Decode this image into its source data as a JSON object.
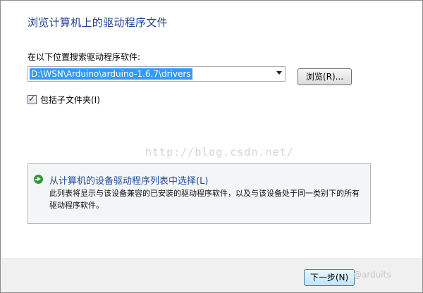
{
  "dialog": {
    "title": "浏览计算机上的驱动程序文件",
    "search_label": "在以下位置搜索驱动程序软件:",
    "path_value": "D:\\WSN\\Arduino\\arduino-1.6.7\\drivers",
    "browse_label": "浏览(R)...",
    "include_subfolders_label": "包括子文件夹(I)",
    "include_subfolders_checked": true,
    "option": {
      "title": "从计算机的设备驱动程序列表中选择(L)",
      "description": "此列表将显示与该设备兼容的已安装的驱动程序软件，以及与该设备处于同一类别下的所有驱动程序软件。"
    },
    "next_label": "下一步(N)",
    "accent_color": "#1f3d8f"
  },
  "watermarks": {
    "center": "http://blog.csdn.net/",
    "footer": "@arduits"
  }
}
